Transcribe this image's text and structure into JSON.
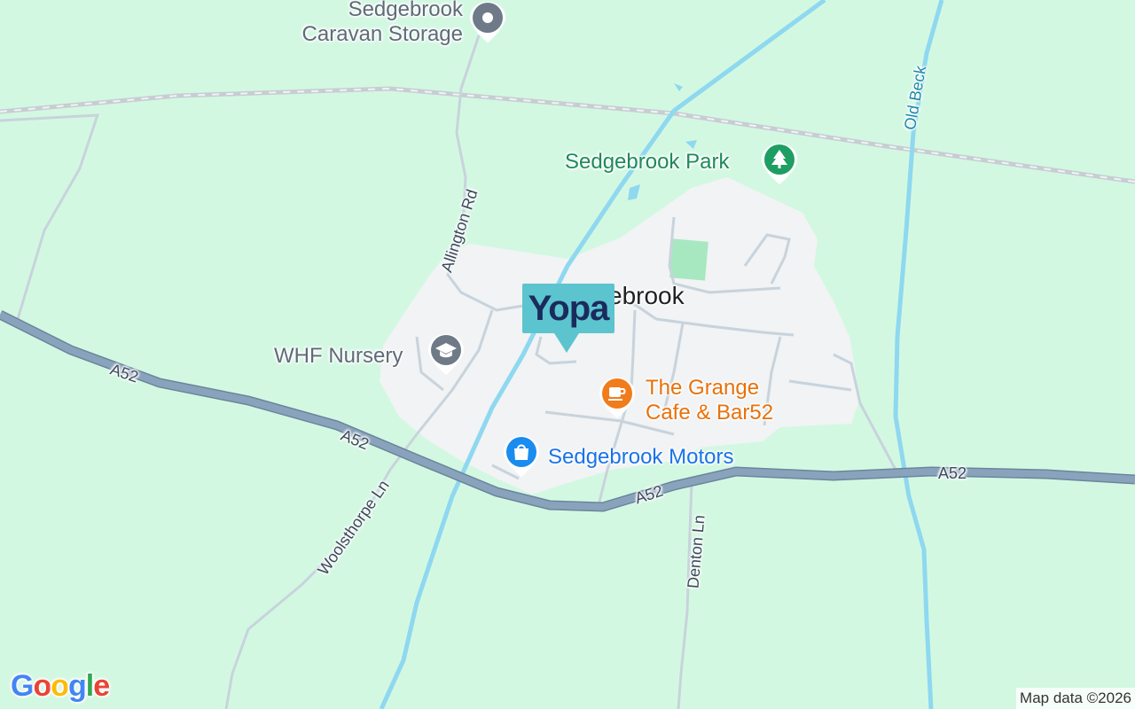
{
  "map": {
    "village_label_visible": "ebrook",
    "marker": {
      "brand_text": "Yopa",
      "color": "#5bc4cf",
      "text_color": "#1b2a5c"
    },
    "pois": [
      {
        "id": "caravan",
        "name_line1": "Sedgebrook",
        "name_line2": "Caravan Storage",
        "icon": "pin-dot-icon",
        "color": "#5f6b78"
      },
      {
        "id": "park",
        "name": "Sedgebrook Park",
        "icon": "tree-icon",
        "color": "#1e8a5a"
      },
      {
        "id": "nursery",
        "name": "WHF Nursery",
        "icon": "graduation-cap-icon",
        "color": "#5f6b78"
      },
      {
        "id": "cafe",
        "name_line1": "The Grange",
        "name_line2": "Cafe & Bar52",
        "icon": "coffee-cup-icon",
        "color": "#e8710a"
      },
      {
        "id": "motors",
        "name": "Sedgebrook Motors",
        "icon": "shopping-bag-icon",
        "color": "#1a73e8"
      }
    ],
    "roads": {
      "a52_labels": [
        "A52",
        "A52",
        "A52",
        "A52"
      ],
      "allington": "Allington Rd",
      "woolsthorpe": "Woolsthorpe Ln",
      "denton": "Denton Ln",
      "old_beck": "Old Beck"
    },
    "colors": {
      "land": "#d3f8e2",
      "built": "#f1f3f4",
      "water": "#8ed8f0",
      "trunk_road": "#8aa3bd",
      "minor_road": "#c8d3dc"
    }
  },
  "footer": {
    "logo": "Google",
    "copyright": "Map data ©2026"
  }
}
